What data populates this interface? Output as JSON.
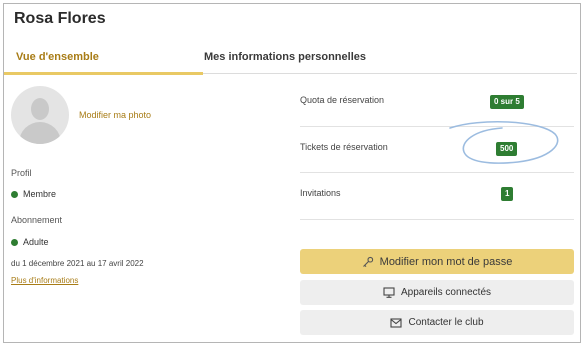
{
  "profile": {
    "name": "Rosa Flores",
    "edit_photo_label": "Modifier ma photo"
  },
  "tabs": [
    {
      "label": "Vue d'ensemble",
      "active": true
    },
    {
      "label": "Mes informations personnelles",
      "active": false
    }
  ],
  "membership": {
    "profile_label": "Profil",
    "profile_value": "Membre",
    "subscription_label": "Abonnement",
    "subscription_value": "Adulte",
    "dates": "du 1 décembre 2021 au 17 avril 2022",
    "more_link": "Plus d'informations",
    "status_color": "#2e7d32"
  },
  "stats": [
    {
      "label": "Quota de réservation",
      "value": "0 sur 5"
    },
    {
      "label": "Tickets de réservation",
      "value": "500"
    },
    {
      "label": "Invitations",
      "value": "1"
    }
  ],
  "actions": {
    "change_password": "Modifier mon mot de passe",
    "devices": "Appareils connectés",
    "contact": "Contacter le club"
  },
  "colors": {
    "accent": "#a87c16",
    "primary_button": "#ecd17a",
    "badge": "#2e7d32",
    "annotation": "#9cbce0"
  }
}
